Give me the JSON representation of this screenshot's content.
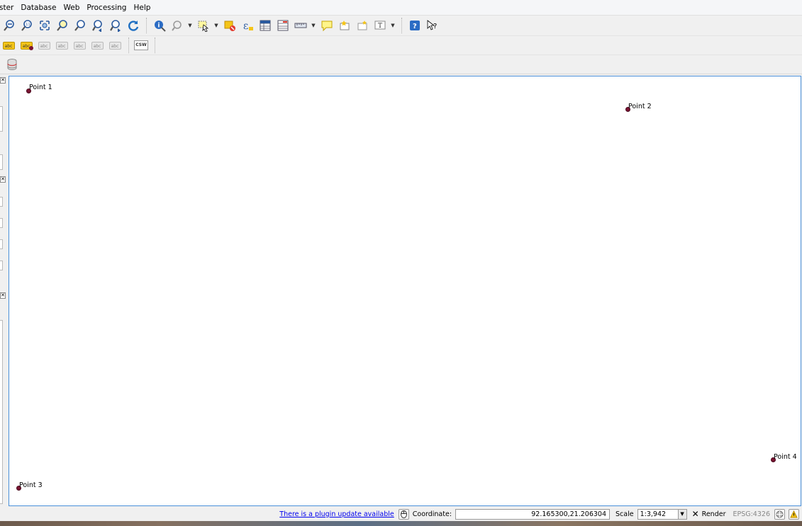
{
  "menubar": {
    "items": [
      "ster",
      "Database",
      "Web",
      "Processing",
      "Help"
    ]
  },
  "toolbar1": {
    "icons": [
      "zoom-out-icon",
      "zoom-native-icon",
      "zoom-full-icon",
      "zoom-to-selection-icon",
      "zoom-to-layer-icon",
      "zoom-last-icon",
      "zoom-next-icon",
      "refresh-icon",
      "identify-icon",
      "touch-zoom-icon",
      "select-features-icon",
      "deselect-icon",
      "field-calculator-icon",
      "attribute-table-icon",
      "statistics-icon",
      "measure-icon",
      "map-tips-icon",
      "new-bookmark-icon",
      "show-bookmarks-icon",
      "text-annotation-icon",
      "help-icon",
      "whats-this-icon"
    ]
  },
  "toolbar2": {
    "icons": [
      "label-tool-icon",
      "pin-labels-icon",
      "show-hide-labels-icon",
      "move-label-icon",
      "rotate-label-icon",
      "change-label-icon",
      "label-properties-icon"
    ],
    "csw_label": "CSW"
  },
  "toolbar3": {
    "icons": [
      "database-icon"
    ]
  },
  "map": {
    "point_color": "#7a1432",
    "points": [
      {
        "label": "Point 1"
      },
      {
        "label": "Point 2"
      },
      {
        "label": "Point 3"
      },
      {
        "label": "Point 4"
      }
    ]
  },
  "statusbar": {
    "plugin_update_text": "There is a plugin update available",
    "coordinate_label": "Coordinate:",
    "coordinate_value": "92.165300,21.206304",
    "scale_label": "Scale",
    "scale_value": "1:3,942",
    "render_label": "Render",
    "crs_label": "EPSG:4326"
  },
  "colors": {
    "canvas_border": "#4a90d9",
    "link": "#0000ee"
  }
}
